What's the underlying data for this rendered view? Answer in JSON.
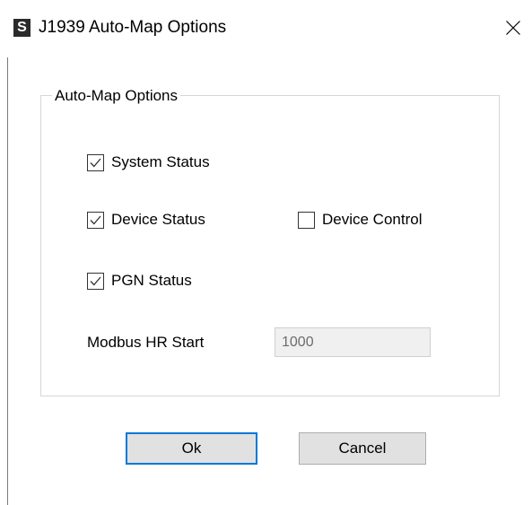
{
  "titlebar": {
    "app_icon_glyph": "S",
    "app_icon_name": "app-logo-icon",
    "title": "J1939 Auto-Map Options",
    "close_icon": "close-icon"
  },
  "group": {
    "legend": "Auto-Map Options"
  },
  "options": {
    "system_status": {
      "label": "System Status",
      "checked": true
    },
    "device_status": {
      "label": "Device Status",
      "checked": true
    },
    "device_control": {
      "label": "Device Control",
      "checked": false
    },
    "pgn_status": {
      "label": "PGN Status",
      "checked": true
    }
  },
  "modbus": {
    "label": "Modbus HR Start",
    "value": "1000",
    "disabled": true
  },
  "buttons": {
    "ok_label": "Ok",
    "cancel_label": "Cancel"
  },
  "colors": {
    "focus_accent": "#0078d7",
    "button_face": "#e1e1e1",
    "disabled_field": "#f0f0f0"
  }
}
